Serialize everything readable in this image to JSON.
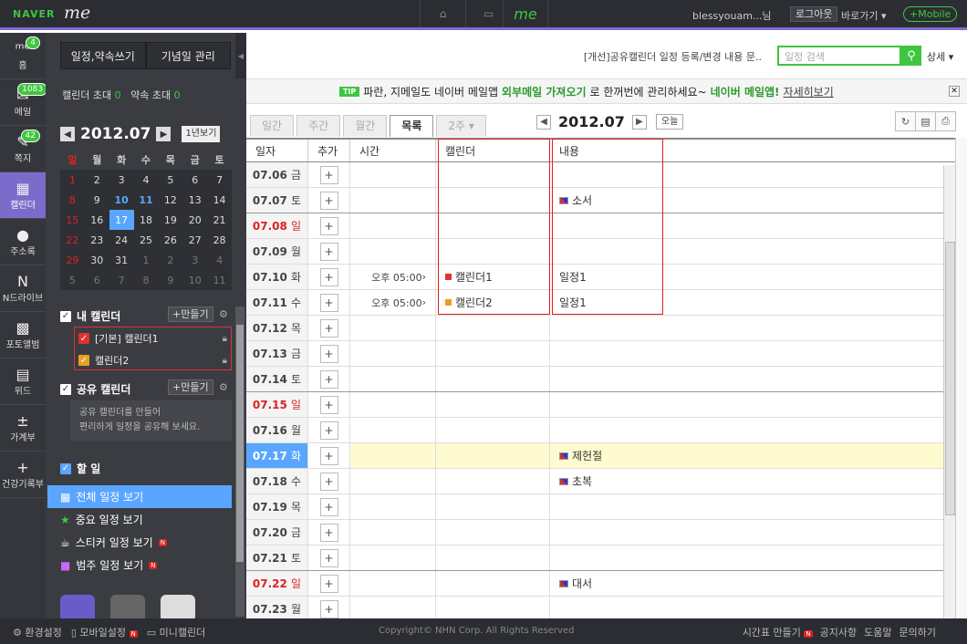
{
  "topbar": {
    "logo": "NAVER",
    "logo_me": "me",
    "nav_me": "me",
    "user": "blessyouam...님",
    "logout": "로그아웃",
    "shortcut": "바로가기",
    "mobile": "+Mobile"
  },
  "leftnav": [
    {
      "label": "홈",
      "badge": "4"
    },
    {
      "label": "메일",
      "badge": "1083"
    },
    {
      "label": "쪽지",
      "badge": "42"
    },
    {
      "label": "캘린더",
      "badge": ""
    },
    {
      "label": "주소록",
      "badge": ""
    },
    {
      "label": "N드라이브",
      "badge": ""
    },
    {
      "label": "포토앨범",
      "badge": ""
    },
    {
      "label": "위드",
      "badge": ""
    },
    {
      "label": "가계부",
      "badge": ""
    },
    {
      "label": "건강기록부",
      "badge": ""
    }
  ],
  "sidepanel": {
    "btn_write": "일정,약속쓰기",
    "btn_anniv": "기념일 관리",
    "invite_cal": "캘린더 초대",
    "invite_cal_count": "0",
    "invite_appt": "약속 초대",
    "invite_appt_count": "0",
    "mini_title": "2012.07",
    "year_view": "1년보기",
    "weekdays": [
      "일",
      "월",
      "화",
      "수",
      "목",
      "금",
      "토"
    ],
    "weeks": [
      [
        "1",
        "2",
        "3",
        "4",
        "5",
        "6",
        "7"
      ],
      [
        "8",
        "9",
        "10",
        "11",
        "12",
        "13",
        "14"
      ],
      [
        "15",
        "16",
        "17",
        "18",
        "19",
        "20",
        "21"
      ],
      [
        "22",
        "23",
        "24",
        "25",
        "26",
        "27",
        "28"
      ],
      [
        "29",
        "30",
        "31",
        "1",
        "2",
        "3",
        "4"
      ],
      [
        "5",
        "6",
        "7",
        "8",
        "9",
        "10",
        "11"
      ]
    ],
    "my_cal": "내 캘린더",
    "make": "+만들기",
    "cal1": "[기본] 캘린더1",
    "cal2": "캘린더2",
    "shared_cal": "공유 캘린더",
    "shared_desc1": "공유 캘린더를 만들어",
    "shared_desc2": "편리하게 일정을 공유해 보세요.",
    "todo": "할 일",
    "views": [
      "전체 일정 보기",
      "중요 일정 보기",
      "스티커 일정 보기",
      "범주 일정 보기"
    ],
    "new_badge": "N"
  },
  "main": {
    "notice": "[개선]공유캘린더 일정 등록/변경 내용 문..",
    "search_placeholder": "일정 검색",
    "detail": "상세",
    "tip_badge": "TIP",
    "tip_text1": "파란, 지메일도 네이버 메일앱",
    "tip_bold1": "외부메일 가져오기",
    "tip_text2": "로 한꺼번에 관리하세요~",
    "tip_bold2": "네이버 메일앱!",
    "tip_link": "자세히보기",
    "tabs": [
      "일간",
      "주간",
      "월간",
      "목록",
      "2주"
    ],
    "date_title": "2012.07",
    "today": "오늘",
    "headers": [
      "일자",
      "추가",
      "시간",
      "캘린더",
      "내용"
    ]
  },
  "rows": [
    {
      "date": "07.06",
      "day": "금",
      "time": "",
      "cal": "",
      "content": "",
      "type": ""
    },
    {
      "date": "07.07",
      "day": "토",
      "time": "",
      "cal": "",
      "content": "소서",
      "type": "flag"
    },
    {
      "date": "07.08",
      "day": "일",
      "time": "",
      "cal": "",
      "content": "",
      "type": "sun"
    },
    {
      "date": "07.09",
      "day": "월",
      "time": "",
      "cal": "",
      "content": "",
      "type": ""
    },
    {
      "date": "07.10",
      "day": "화",
      "time": "오후 05:00",
      "cal": "캘린더1",
      "content": "일정1",
      "type": "red"
    },
    {
      "date": "07.11",
      "day": "수",
      "time": "오후 05:00",
      "cal": "캘린더2",
      "content": "일정1",
      "type": "orange"
    },
    {
      "date": "07.12",
      "day": "목",
      "time": "",
      "cal": "",
      "content": "",
      "type": ""
    },
    {
      "date": "07.13",
      "day": "금",
      "time": "",
      "cal": "",
      "content": "",
      "type": ""
    },
    {
      "date": "07.14",
      "day": "토",
      "time": "",
      "cal": "",
      "content": "",
      "type": ""
    },
    {
      "date": "07.15",
      "day": "일",
      "time": "",
      "cal": "",
      "content": "",
      "type": "sun"
    },
    {
      "date": "07.16",
      "day": "월",
      "time": "",
      "cal": "",
      "content": "",
      "type": ""
    },
    {
      "date": "07.17",
      "day": "화",
      "time": "",
      "cal": "",
      "content": "제헌절",
      "type": "today"
    },
    {
      "date": "07.18",
      "day": "수",
      "time": "",
      "cal": "",
      "content": "초복",
      "type": "flag"
    },
    {
      "date": "07.19",
      "day": "목",
      "time": "",
      "cal": "",
      "content": "",
      "type": ""
    },
    {
      "date": "07.20",
      "day": "금",
      "time": "",
      "cal": "",
      "content": "",
      "type": ""
    },
    {
      "date": "07.21",
      "day": "토",
      "time": "",
      "cal": "",
      "content": "",
      "type": ""
    },
    {
      "date": "07.22",
      "day": "일",
      "time": "",
      "cal": "",
      "content": "대서",
      "type": "sun"
    },
    {
      "date": "07.23",
      "day": "월",
      "time": "",
      "cal": "",
      "content": "",
      "type": ""
    }
  ],
  "footer": {
    "settings": "환경설정",
    "mobile_settings": "모바일설정",
    "mini_cal": "미니캘린더",
    "copyright": "Copyright© NHN Corp. All Rights Reserved",
    "timetable": "시간표 만들기",
    "notice": "공지사항",
    "help": "도움말",
    "inquiry": "문의하기"
  },
  "colors": {
    "accent": "#7b6ccc",
    "green": "#3ec63e",
    "today": "#5aa6ff",
    "red": "#dd2222",
    "cal1": "#e03030",
    "cal2": "#e8a020"
  }
}
